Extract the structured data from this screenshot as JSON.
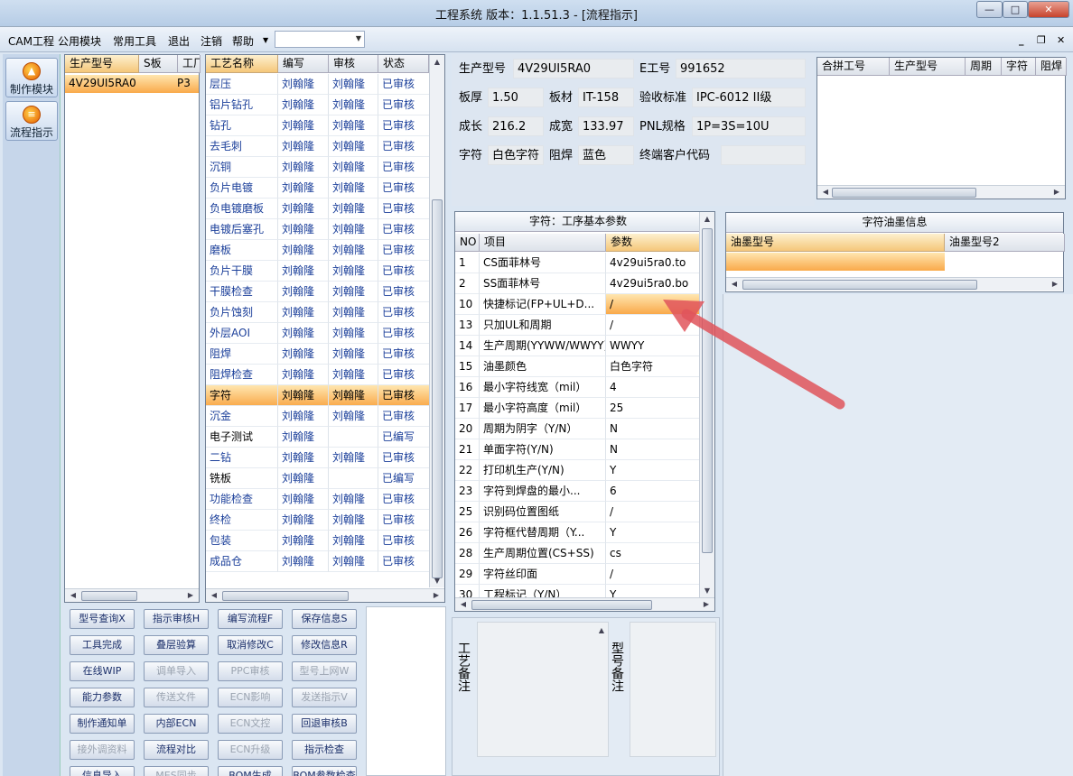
{
  "window": {
    "title": "工程系统   版本：1.1.51.3 - [流程指示]"
  },
  "menu": [
    "CAM工程",
    "公用模块",
    "常用工具",
    "退出",
    "注销",
    "帮助"
  ],
  "left_nav": [
    {
      "label": "制作模块",
      "icon": "flame-icon"
    },
    {
      "label": "流程指示",
      "icon": "flow-icon"
    }
  ],
  "model_list": {
    "headers": [
      "生产型号",
      "S板",
      "工厂"
    ],
    "rows": [
      [
        "4V29UI5RA0",
        "",
        "P3"
      ]
    ]
  },
  "process_table": {
    "headers": [
      "工艺名称",
      "编写",
      "审核",
      "状态"
    ],
    "rows": [
      [
        "层压",
        "刘翰隆",
        "刘翰隆",
        "已审核"
      ],
      [
        "铝片钻孔",
        "刘翰隆",
        "刘翰隆",
        "已审核"
      ],
      [
        "钻孔",
        "刘翰隆",
        "刘翰隆",
        "已审核"
      ],
      [
        "去毛刺",
        "刘翰隆",
        "刘翰隆",
        "已审核"
      ],
      [
        "沉铜",
        "刘翰隆",
        "刘翰隆",
        "已审核"
      ],
      [
        "负片电镀",
        "刘翰隆",
        "刘翰隆",
        "已审核"
      ],
      [
        "负电镀磨板",
        "刘翰隆",
        "刘翰隆",
        "已审核"
      ],
      [
        "电镀后塞孔",
        "刘翰隆",
        "刘翰隆",
        "已审核"
      ],
      [
        "磨板",
        "刘翰隆",
        "刘翰隆",
        "已审核"
      ],
      [
        "负片干膜",
        "刘翰隆",
        "刘翰隆",
        "已审核"
      ],
      [
        "干膜检查",
        "刘翰隆",
        "刘翰隆",
        "已审核"
      ],
      [
        "负片蚀刻",
        "刘翰隆",
        "刘翰隆",
        "已审核"
      ],
      [
        "外层AOI",
        "刘翰隆",
        "刘翰隆",
        "已审核"
      ],
      [
        "阻焊",
        "刘翰隆",
        "刘翰隆",
        "已审核"
      ],
      [
        "阻焊检查",
        "刘翰隆",
        "刘翰隆",
        "已审核"
      ],
      [
        "字符",
        "刘翰隆",
        "刘翰隆",
        "已审核"
      ],
      [
        "沉金",
        "刘翰隆",
        "刘翰隆",
        "已审核"
      ],
      [
        "电子测试",
        "刘翰隆",
        "",
        "已编写"
      ],
      [
        "二钻",
        "刘翰隆",
        "刘翰隆",
        "已审核"
      ],
      [
        "铣板",
        "刘翰隆",
        "",
        "已编写"
      ],
      [
        "功能检查",
        "刘翰隆",
        "刘翰隆",
        "已审核"
      ],
      [
        "终检",
        "刘翰隆",
        "刘翰隆",
        "已审核"
      ],
      [
        "包装",
        "刘翰隆",
        "刘翰隆",
        "已审核"
      ],
      [
        "成品仓",
        "刘翰隆",
        "刘翰隆",
        "已审核"
      ]
    ],
    "selected_index": 15
  },
  "info": {
    "model_label": "生产型号",
    "model": "4V29UI5RA0",
    "e_label": "E工号",
    "e_no": "991652",
    "thick_label": "板厚",
    "thick": "1.50",
    "mat_label": "板材",
    "mat": "IT-158",
    "std_label": "验收标准",
    "std": "IPC-6012 II级",
    "grow_label": "成长",
    "grow": "216.2",
    "final_label": "成宽",
    "final": "133.97",
    "pnl_label": "PNL规格",
    "pnl": "1P=3S=10U",
    "char_label": "字符",
    "char": "白色字符",
    "mask_label": "阻焊",
    "mask": "蓝色",
    "cust_label": "终端客户代码",
    "cust": ""
  },
  "merge_table": {
    "headers": [
      "合拼工号",
      "生产型号",
      "周期",
      "字符",
      "阻焊"
    ]
  },
  "params": {
    "title": "字符：工序基本参数",
    "headers": [
      "NO",
      "项目",
      "参数"
    ],
    "rows": [
      [
        "1",
        "CS面菲林号",
        "4v29ui5ra0.to"
      ],
      [
        "2",
        "SS面菲林号",
        "4v29ui5ra0.bo"
      ],
      [
        "10",
        "快捷标记(FP+UL+D...",
        "/"
      ],
      [
        "13",
        "只加UL和周期",
        "/"
      ],
      [
        "14",
        "生产周期(YYWW/WWYY)",
        "WWYY"
      ],
      [
        "15",
        "油墨颜色",
        "白色字符"
      ],
      [
        "16",
        "最小字符线宽（mil）",
        "4"
      ],
      [
        "17",
        "最小字符高度（mil）",
        "25"
      ],
      [
        "20",
        "周期为阴字（Y/N）",
        "N"
      ],
      [
        "21",
        "单面字符(Y/N)",
        "N"
      ],
      [
        "22",
        "打印机生产(Y/N)",
        "Y"
      ],
      [
        "23",
        "字符到焊盘的最小...",
        "6"
      ],
      [
        "25",
        "识别码位置图纸",
        "/"
      ],
      [
        "26",
        "字符框代替周期（Y...",
        "Y"
      ],
      [
        "28",
        "生产周期位置(CS+SS)",
        "cs"
      ],
      [
        "29",
        "字符丝印面",
        "/"
      ],
      [
        "30",
        "工程标记（Y/N）",
        "Y"
      ]
    ],
    "selected_index": 2
  },
  "ink": {
    "title": "字符油墨信息",
    "headers": [
      "油墨型号",
      "油墨型号2"
    ]
  },
  "notes": {
    "proc_label": "工艺备注",
    "model_label": "型号备注"
  },
  "buttons": [
    [
      {
        "l": "型号查询X",
        "d": false
      },
      {
        "l": "指示审核H",
        "d": false
      },
      {
        "l": "编写流程F",
        "d": false
      },
      {
        "l": "保存信息S",
        "d": false
      }
    ],
    [
      {
        "l": "工具完成",
        "d": false
      },
      {
        "l": "叠层验算",
        "d": false
      },
      {
        "l": "取消修改C",
        "d": false
      },
      {
        "l": "修改信息R",
        "d": false
      }
    ],
    [
      {
        "l": "在线WIP",
        "d": false
      },
      {
        "l": "调单导入",
        "d": true
      },
      {
        "l": "PPC审核",
        "d": true
      },
      {
        "l": "型号上网W",
        "d": true
      }
    ],
    [
      {
        "l": "能力参数",
        "d": false
      },
      {
        "l": "传送文件",
        "d": true
      },
      {
        "l": "ECN影响",
        "d": true
      },
      {
        "l": "发送指示V",
        "d": true
      }
    ],
    [
      {
        "l": "制作通知单",
        "d": false
      },
      {
        "l": "内部ECN",
        "d": false
      },
      {
        "l": "ECN文控",
        "d": true
      },
      {
        "l": "回退审核B",
        "d": false
      }
    ],
    [
      {
        "l": "接外调资料",
        "d": true
      },
      {
        "l": "流程对比",
        "d": false
      },
      {
        "l": "ECN升级",
        "d": true
      },
      {
        "l": "指示检查",
        "d": false
      }
    ],
    [
      {
        "l": "信息导入",
        "d": false
      },
      {
        "l": "MES同步",
        "d": true
      },
      {
        "l": "BOM生成",
        "d": false
      },
      {
        "l": "BOM参数检查",
        "d": false
      }
    ]
  ],
  "colors": {
    "accent": "#f9a94a",
    "arrow": "#e0555c",
    "link_text": "#1b3f9a"
  }
}
